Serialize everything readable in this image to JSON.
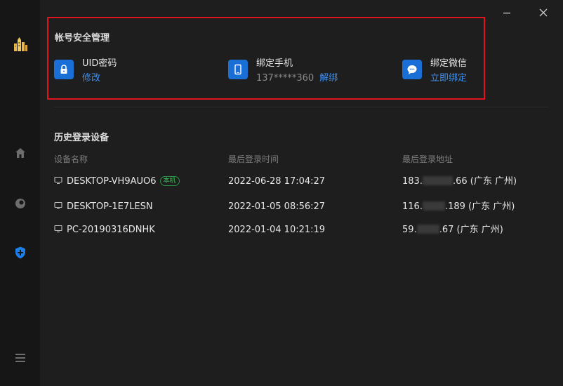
{
  "window": {
    "minimize_icon": "minimize-icon",
    "close_icon": "close-icon"
  },
  "sidebar": {
    "items": [
      {
        "name": "logo",
        "icon": "city-logo-icon"
      },
      {
        "name": "home",
        "icon": "home-icon"
      },
      {
        "name": "record",
        "icon": "disc-icon"
      },
      {
        "name": "security",
        "icon": "shield-plus-icon",
        "active": true
      },
      {
        "name": "menu",
        "icon": "menu-icon"
      }
    ]
  },
  "account_security": {
    "title": "帐号安全管理",
    "items": [
      {
        "title": "UID密码",
        "action": "修改",
        "icon": "lock-icon"
      },
      {
        "title": "绑定手机",
        "value": "137*****360",
        "action": "解绑",
        "icon": "phone-icon"
      },
      {
        "title": "绑定微信",
        "action": "立即绑定",
        "icon": "wechat-icon"
      }
    ]
  },
  "login_history": {
    "title": "历史登录设备",
    "columns": [
      "设备名称",
      "最后登录时间",
      "最后登录地址"
    ],
    "current_badge": "本机",
    "rows": [
      {
        "device": "DESKTOP-VH9AUO6",
        "current": true,
        "time": "2022-06-28 17:04:27",
        "ip_start": "183.",
        "ip_end": ".66",
        "location": "(广东 广州)"
      },
      {
        "device": "DESKTOP-1E7LESN",
        "current": false,
        "time": "2022-01-05 08:56:27",
        "ip_start": "116.",
        "ip_end": ".189",
        "location": "(广东 广州)"
      },
      {
        "device": "PC-20190316DNHK",
        "current": false,
        "time": "2022-01-04 10:21:19",
        "ip_start": "59.",
        "ip_end": ".67",
        "location": "(广东 广州)"
      }
    ]
  },
  "colors": {
    "accent": "#1a6fd6",
    "link": "#3d8ff0",
    "highlight": "#e0141e",
    "badge": "#3fbf5a"
  }
}
